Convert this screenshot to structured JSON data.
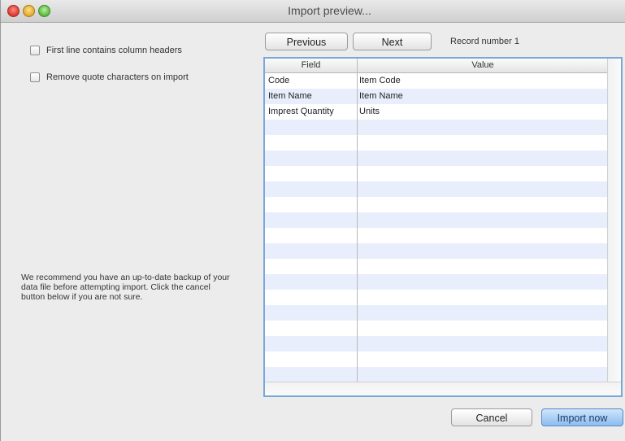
{
  "window": {
    "title": "Import preview..."
  },
  "options": {
    "first_line_headers": "First line contains column headers",
    "remove_quotes": "Remove quote characters on import"
  },
  "warning_text": "We recommend you have an up-to-date backup of your data file before attempting import. Click the cancel button below if you are not sure.",
  "nav": {
    "previous_label": "Previous",
    "next_label": "Next",
    "record_label": "Record number 1"
  },
  "table": {
    "columns": [
      "Field",
      "Value"
    ],
    "rows": [
      {
        "field": "Code",
        "value": "Item Code"
      },
      {
        "field": "Item Name",
        "value": "Item Name"
      },
      {
        "field": "Imprest Quantity",
        "value": "Units"
      }
    ]
  },
  "footer": {
    "cancel_label": "Cancel",
    "import_label": "Import now"
  }
}
